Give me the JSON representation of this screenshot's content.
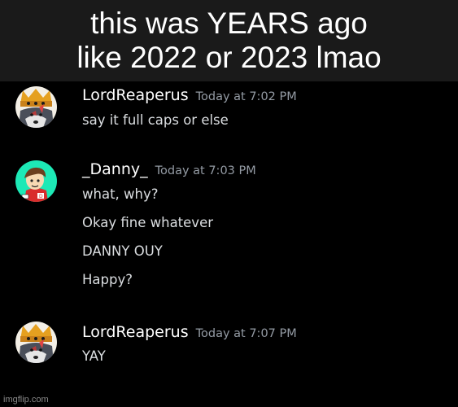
{
  "caption": {
    "lines": [
      "this was YEARS ago",
      "like 2022 or 2023 lmao"
    ]
  },
  "messages": [
    {
      "username": "LordReaperus",
      "timestamp": "Today at 7:02 PM",
      "avatar_icon": "wolf-king-avatar",
      "lines": [
        "say it full caps or else"
      ]
    },
    {
      "username": "_Danny_",
      "timestamp": "Today at 7:03 PM",
      "avatar_icon": "cartoon-boy-avatar",
      "lines": [
        "what, why?",
        "Okay fine whatever",
        "DANNY OUY",
        "Happy?"
      ]
    },
    {
      "username": "LordReaperus",
      "timestamp": "Today at 7:07 PM",
      "avatar_icon": "wolf-king-avatar",
      "lines": [
        "YAY"
      ]
    }
  ],
  "watermark": "imgflip.com",
  "colors": {
    "caption_bg": "#1a1a1a",
    "chat_bg": "#000000",
    "username": "#ffffff",
    "timestamp": "#949ba4",
    "message_text": "#dbdee1",
    "danny_avatar_bg": "#1de9b6"
  }
}
